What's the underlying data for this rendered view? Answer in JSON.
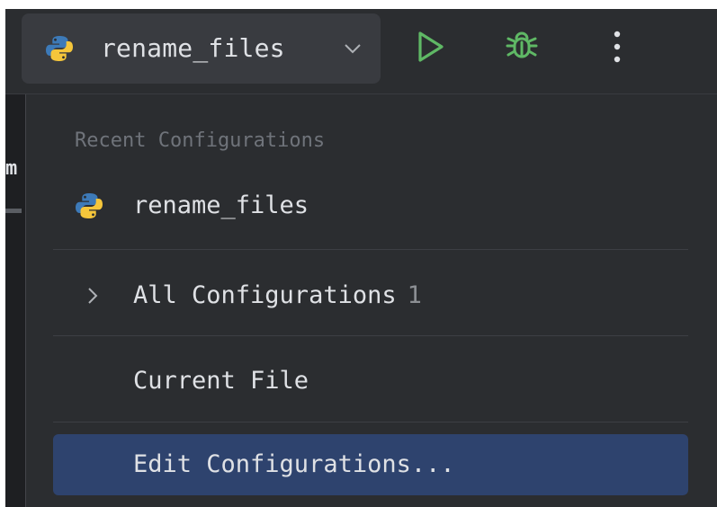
{
  "toolbar": {
    "run_config_name": "rename_files",
    "run_config_icon": "python-icon",
    "dropdown_icon": "chevron-down-icon",
    "run_icon": "play-icon",
    "debug_icon": "bug-icon",
    "more_icon": "vertical-ellipsis-icon"
  },
  "editor": {
    "fragment": "m"
  },
  "popup": {
    "section_title": "Recent Configurations",
    "recent_items": [
      {
        "label": "rename_files",
        "icon": "python-icon"
      }
    ],
    "all_configurations": {
      "label": "All Configurations",
      "count": "1",
      "icon": "chevron-right-icon"
    },
    "current_file": {
      "label": "Current File"
    },
    "edit_configurations": {
      "label": "Edit Configurations..."
    }
  },
  "colors": {
    "toolbar_bg": "#2b2d30",
    "popup_bg": "#2b2d30",
    "run_green": "#5fb865",
    "selection_bg": "#2e436e",
    "text_primary": "#dfe1e5",
    "text_muted": "#6f737a"
  }
}
